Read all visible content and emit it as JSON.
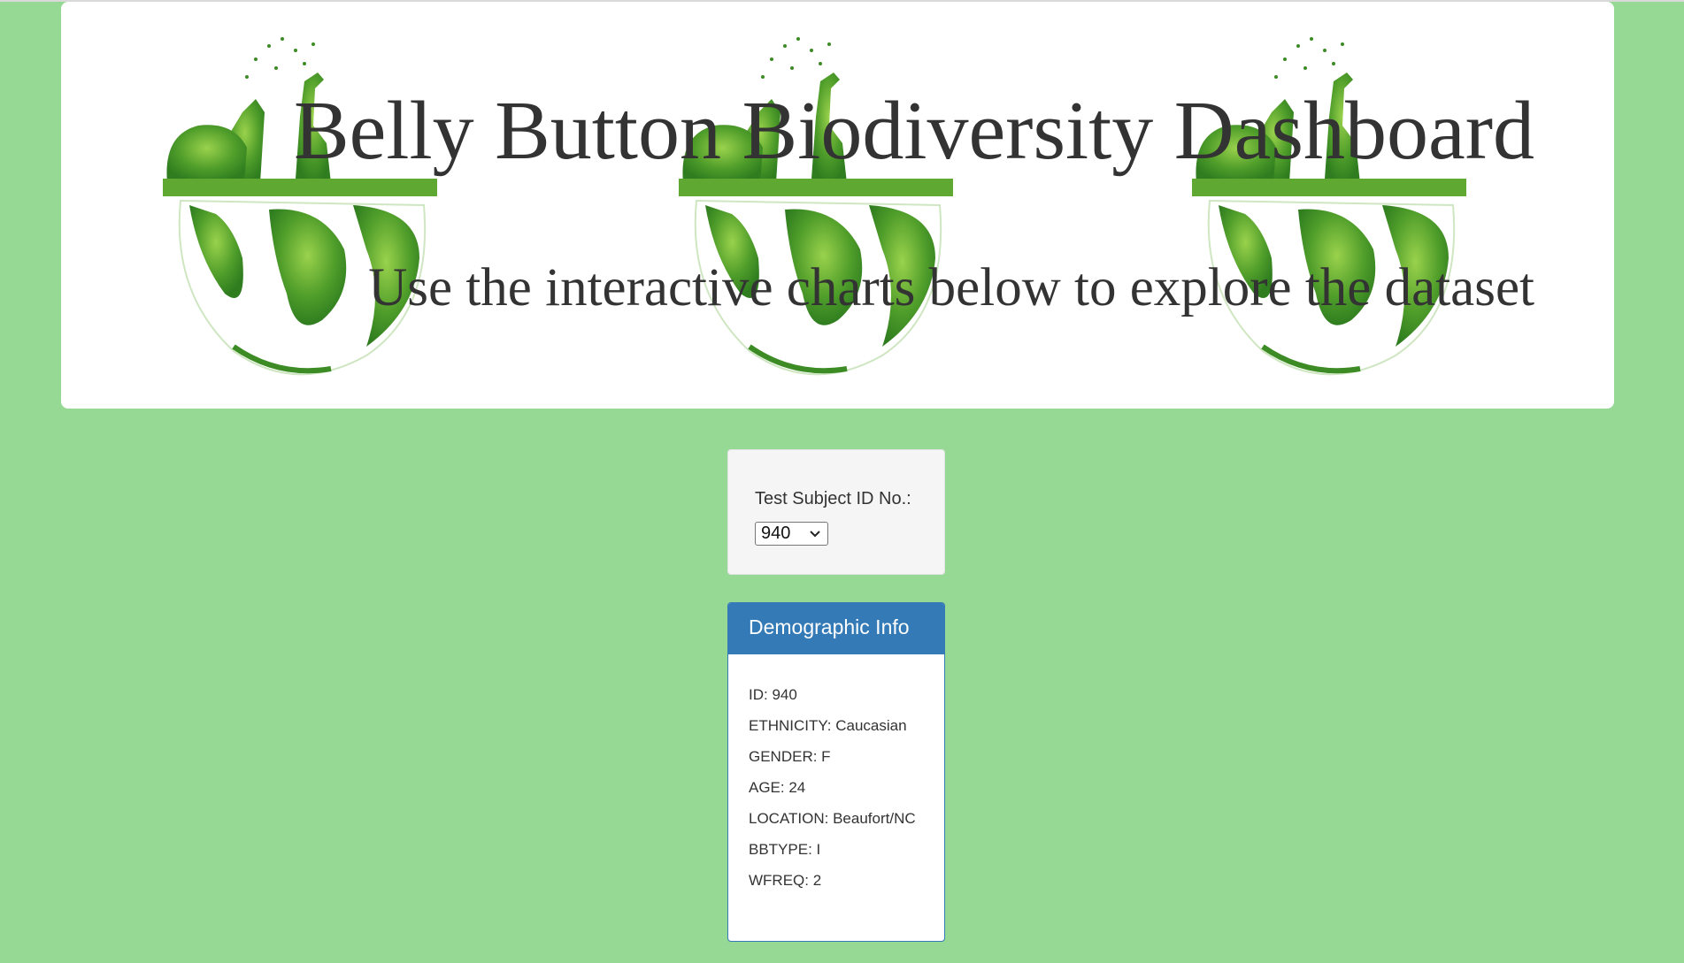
{
  "header": {
    "title": "Belly Button Biodiversity Dashboard",
    "subtitle": "Use the interactive charts below to explore the dataset"
  },
  "selector": {
    "label": "Test Subject ID No.:",
    "selected_value": "940"
  },
  "demographics": {
    "heading": "Demographic Info",
    "lines": [
      "ID: 940",
      "ETHNICITY: Caucasian",
      "GENDER: F",
      "AGE: 24",
      "LOCATION: Beaufort/NC",
      "BBTYPE: I",
      "WFREQ: 2"
    ]
  },
  "colors": {
    "page_background": "#96d995",
    "panel_primary": "#337ab7",
    "foliage_dark": "#2f7d1f",
    "foliage_light": "#7cc242"
  },
  "icons": {
    "header_art": "globe-wildlife-icon",
    "select_arrow": "chevron-down-icon"
  }
}
